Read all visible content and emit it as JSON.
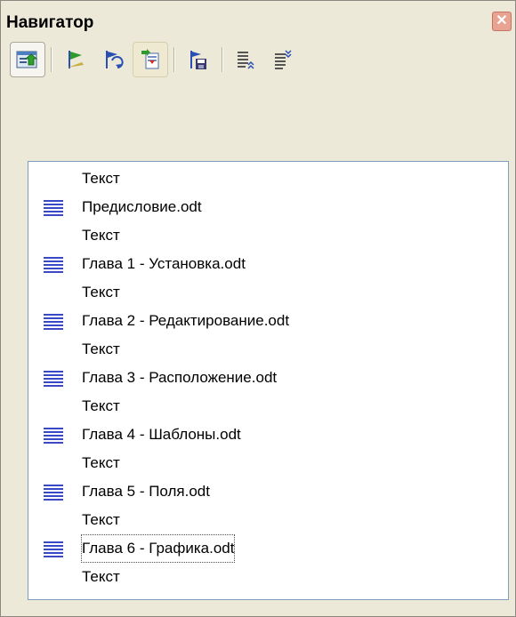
{
  "window": {
    "title": "Навигатор",
    "close_symbol": "✕"
  },
  "toolbar": {
    "buttons": [
      {
        "icon": "toggle-navigator-icon",
        "state": "pressed"
      },
      {
        "icon": "promote-flag-icon",
        "state": "normal"
      },
      {
        "icon": "demote-flag-icon",
        "state": "normal"
      },
      {
        "icon": "insert-icon",
        "state": "hover"
      },
      {
        "icon": "save-as-icon",
        "state": "normal"
      },
      {
        "icon": "move-up-icon",
        "state": "normal"
      },
      {
        "icon": "move-down-icon",
        "state": "normal"
      }
    ]
  },
  "list": {
    "items": [
      {
        "label": "Текст",
        "icon": null
      },
      {
        "label": "Предисловие.odt",
        "icon": "document-icon"
      },
      {
        "label": "Текст",
        "icon": null
      },
      {
        "label": "Глава 1 - Установка.odt",
        "icon": "document-icon"
      },
      {
        "label": "Текст",
        "icon": null
      },
      {
        "label": "Глава 2 - Редактирование.odt",
        "icon": "document-icon"
      },
      {
        "label": "Текст",
        "icon": null
      },
      {
        "label": "Глава 3 - Расположение.odt",
        "icon": "document-icon"
      },
      {
        "label": "Текст",
        "icon": null
      },
      {
        "label": "Глава 4 - Шаблоны.odt",
        "icon": "document-icon"
      },
      {
        "label": "Текст",
        "icon": null
      },
      {
        "label": "Глава 5 - Поля.odt",
        "icon": "document-icon"
      },
      {
        "label": "Текст",
        "icon": null
      },
      {
        "label": "Глава 6 - Графика.odt",
        "icon": "document-icon",
        "selected": true
      },
      {
        "label": "Текст",
        "icon": null
      }
    ]
  },
  "colors": {
    "window_bg": "#ece9d8",
    "list_bg": "#ffffff",
    "list_border": "#7f9db9",
    "doc_icon_blue": "#3a48c8",
    "flag_green": "#2e9a2e",
    "flag_blue": "#2a4fb3"
  }
}
